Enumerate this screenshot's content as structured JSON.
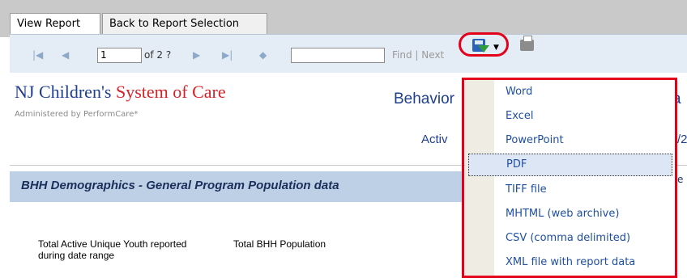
{
  "tabs": {
    "view_report": "View Report",
    "back": "Back to Report Selection"
  },
  "toolbar": {
    "page_value": "1",
    "page_of": "of 2 ?",
    "find_label": "Find",
    "find_sep": "|",
    "next_label": "Next"
  },
  "report": {
    "org_name_blue": "NJ Children's",
    "org_name_red": "System of Care",
    "org_sub": "Administered by PerformCare*",
    "title_partial": "Behavior",
    "title_tail": "a",
    "active_partial": "Activ",
    "active_tail": "/2",
    "section_title": "BHH Demographics - General Program Population data",
    "section_tail": "e",
    "col1": "Total Active Unique Youth reported during date range",
    "col2": "Total BHH Population"
  },
  "export_menu": {
    "items": [
      "Word",
      "Excel",
      "PowerPoint",
      "PDF",
      "TIFF file",
      "MHTML (web archive)",
      "CSV (comma delimited)",
      "XML file with report data"
    ],
    "selected": "PDF"
  },
  "colors": {
    "highlight_red": "#e3001b",
    "link_blue": "#1f4fa3",
    "title_blue": "#1f3f8f",
    "section_band": "#bdd0e6"
  },
  "icons": [
    "first-page-icon",
    "prev-page-icon",
    "next-page-icon",
    "last-page-icon",
    "back-icon",
    "save-export-icon",
    "print-icon"
  ]
}
